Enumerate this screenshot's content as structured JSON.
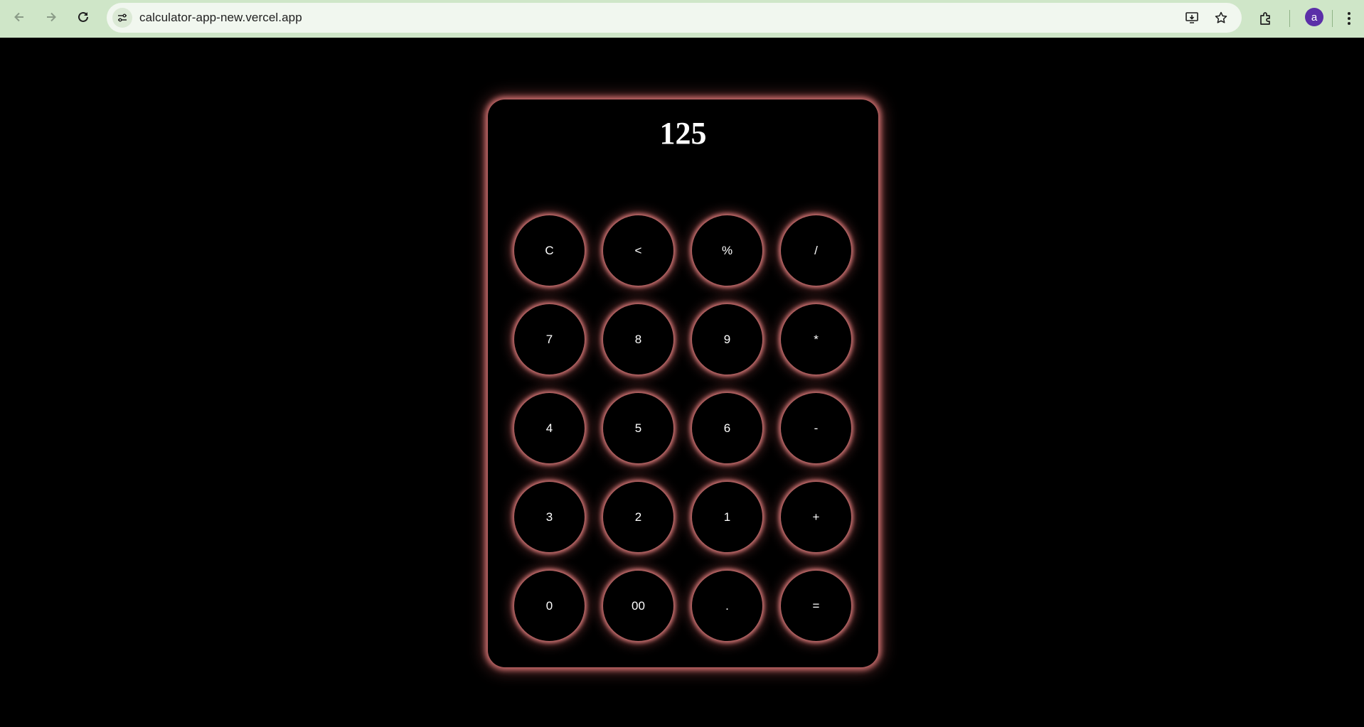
{
  "browser": {
    "url": "calculator-app-new.vercel.app",
    "avatar_letter": "a",
    "icons": [
      "back-arrow-icon",
      "forward-arrow-icon",
      "reload-icon",
      "site-info-icon",
      "install-app-icon",
      "bookmark-star-icon",
      "extensions-icon",
      "menu-kebab-icon"
    ]
  },
  "calculator": {
    "display_value": "125",
    "keys": [
      "C",
      "<",
      "%",
      "/",
      "7",
      "8",
      "9",
      "*",
      "4",
      "5",
      "6",
      "-",
      "3",
      "2",
      "1",
      "+",
      "0",
      "00",
      ".",
      "="
    ]
  },
  "colors": {
    "background": "#000000",
    "glow": "#e07a7a",
    "toolbar": "#cfe6c8",
    "avatar": "#5b2fa8"
  }
}
